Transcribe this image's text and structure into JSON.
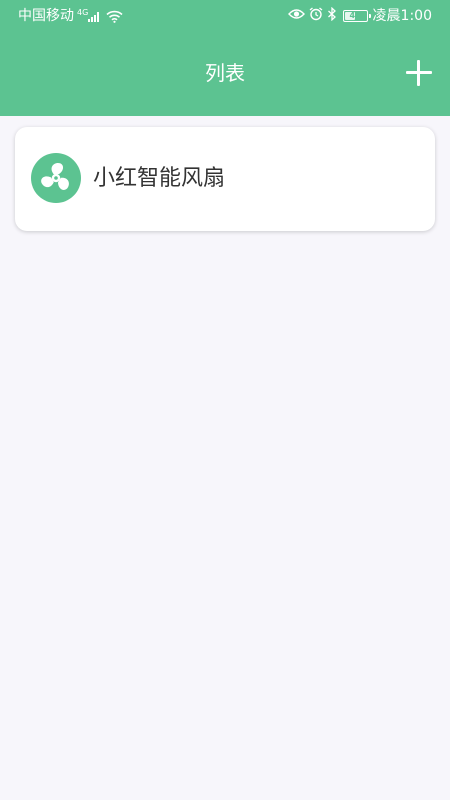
{
  "status_bar": {
    "carrier": "中国移动",
    "network_type": "4G",
    "battery_level": "47",
    "battery_fraction": 0.47,
    "time": "凌晨1:00",
    "icons": [
      "signal-icon",
      "wifi-icon",
      "eye-icon",
      "alarm-icon",
      "bluetooth-icon",
      "battery-icon"
    ]
  },
  "header": {
    "title": "列表",
    "add_icon": "plus-icon"
  },
  "devices": [
    {
      "name": "小红智能风扇",
      "icon": "fan-icon"
    }
  ],
  "colors": {
    "primary": "#5cc391",
    "background": "#f7f6fb",
    "card": "#ffffff",
    "text": "#333333"
  }
}
